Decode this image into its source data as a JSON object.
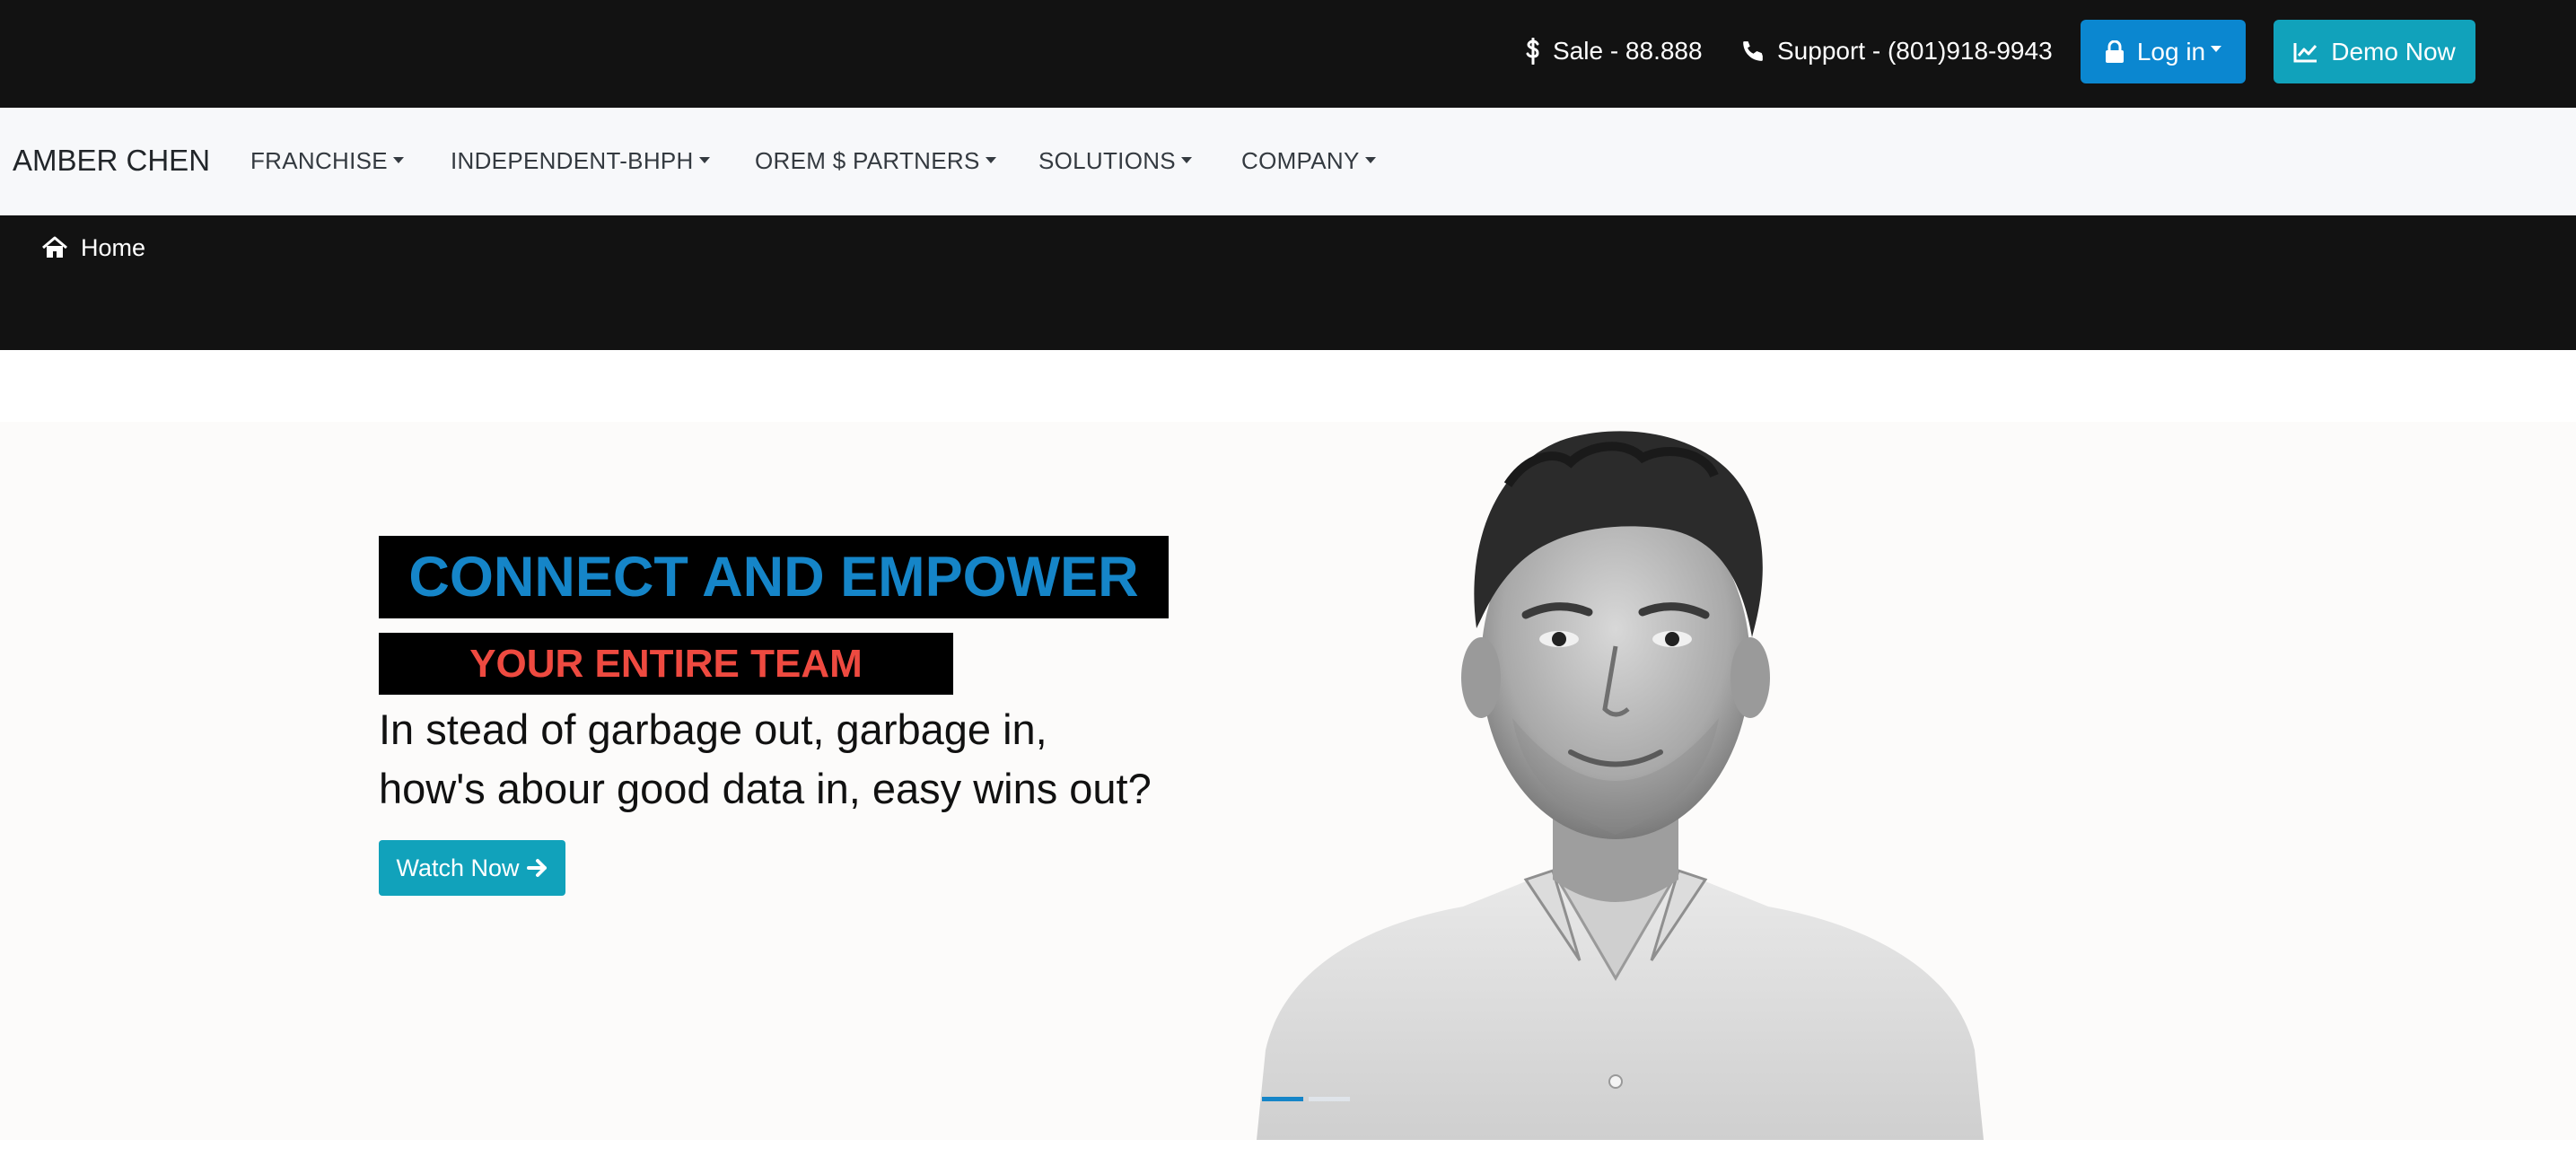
{
  "topbar": {
    "sale_label": "Sale - 88.888",
    "support_label": "Support - (801)918-9943",
    "login_label": "Log in",
    "demo_label": "Demo Now"
  },
  "navbar": {
    "brand": "AMBER CHEN",
    "items": [
      {
        "label": "FRANCHISE"
      },
      {
        "label": "INDEPENDENT-BHPH"
      },
      {
        "label": "OREM $ PARTNERS"
      },
      {
        "label": "SOLUTIONS"
      },
      {
        "label": "COMPANY"
      }
    ]
  },
  "breadcrumb": {
    "home_label": "Home"
  },
  "hero": {
    "headline_1": "CONNECT AND EMPOWER",
    "headline_2": "YOUR ENTIRE TEAM",
    "subtext_line_1": "In stead of garbage out, garbage in,",
    "subtext_line_2": "how's abour good data in, easy wins out?",
    "cta_label": "Watch Now",
    "slides_total": 2,
    "active_slide": 1
  },
  "colors": {
    "topbar_bg": "#121212",
    "login_blue": "#0b87d0",
    "demo_teal": "#11a2bb",
    "headline_blue": "#1585c8",
    "headline_red": "#ee4a40"
  }
}
